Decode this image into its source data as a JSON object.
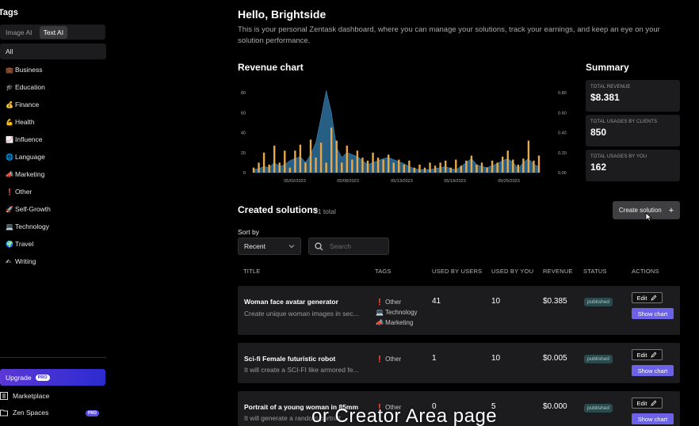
{
  "sidebar": {
    "title": "Tags",
    "toggle": [
      "Image AI",
      "Text AI"
    ],
    "categories": [
      {
        "label": "All",
        "emoji": ""
      },
      {
        "label": "Business",
        "emoji": "💼"
      },
      {
        "label": "Education",
        "emoji": "🎓"
      },
      {
        "label": "Finance",
        "emoji": "💰"
      },
      {
        "label": "Health",
        "emoji": "💪"
      },
      {
        "label": "Influence",
        "emoji": "📈"
      },
      {
        "label": "Language",
        "emoji": "🌐"
      },
      {
        "label": "Marketing",
        "emoji": "📣"
      },
      {
        "label": "Other",
        "emoji": "❗"
      },
      {
        "label": "Self-Growth",
        "emoji": "🚀"
      },
      {
        "label": "Technology",
        "emoji": "💻"
      },
      {
        "label": "Travel",
        "emoji": "🌍"
      },
      {
        "label": "Writing",
        "emoji": "✍"
      }
    ],
    "upgrade_label": "Upgrade",
    "pro": "PRO",
    "marketplace": "Marketplace",
    "zen_spaces": "Zen Spaces"
  },
  "header": {
    "greeting": "Hello, Brightside",
    "intro": "This is your personal Zentask dashboard, where you can manage your solutions, track your earnings, and keep an eye on your solution performance."
  },
  "revenue_title": "Revenue chart",
  "summary": {
    "title": "Summary",
    "cards": [
      {
        "label": "TOTAL REVENUE",
        "value": "$8.381"
      },
      {
        "label": "TOTAL USAGES BY CLIENTS",
        "value": "850"
      },
      {
        "label": "TOTAL USAGES BY YOU",
        "value": "162"
      }
    ]
  },
  "chart_data": {
    "type": "bar",
    "title": "",
    "left_axis_ticks": [
      "80",
      "60",
      "40",
      "20",
      "0"
    ],
    "right_axis_ticks": [
      "0.80",
      "0.60",
      "0.40",
      "0.20",
      "0.00"
    ],
    "x_tick_labels": [
      "05/02/2023",
      "05/08/2023",
      "05/13/2023",
      "05/19/2023",
      "05/25/2023"
    ],
    "ylim": [
      0,
      80
    ],
    "y2lim": [
      0,
      0.8
    ],
    "series": [
      {
        "kind": "area",
        "values": [
          3,
          4,
          6,
          5,
          10,
          6,
          8,
          12,
          14,
          16,
          10,
          18,
          30,
          55,
          82,
          60,
          25,
          15,
          20,
          18,
          16,
          12,
          8,
          10,
          12,
          14,
          15,
          13,
          11,
          9,
          6,
          4,
          3,
          3,
          3,
          4,
          5,
          6,
          4,
          3,
          6,
          10,
          14,
          8,
          6,
          5,
          7,
          9,
          12,
          14,
          10,
          4,
          10,
          14,
          8,
          6
        ]
      },
      {
        "kind": "bar",
        "values": [
          0.05,
          0.1,
          0.2,
          0.08,
          0.27,
          0.1,
          0.22,
          0.05,
          0.22,
          0.28,
          0.1,
          0.33,
          0.15,
          0.3,
          0.1,
          0.45,
          0.32,
          0.1,
          0.27,
          0.13,
          0.22,
          0.15,
          0.12,
          0.2,
          0.15,
          0.13,
          0.18,
          0.1,
          0.13,
          0.08,
          0.12,
          0.05,
          0.08,
          0.05,
          0.1,
          0.07,
          0.1,
          0.12,
          0.05,
          0.13,
          0.07,
          0.12,
          0.17,
          0.08,
          0.1,
          0.05,
          0.12,
          0.1,
          0.16,
          0.22,
          0.13,
          0.08,
          0.14,
          0.32,
          0.12,
          0.17
        ]
      }
    ],
    "colors": {
      "area": "#2d6f9b",
      "bar": "#e8a84a"
    }
  },
  "created": {
    "title": "Created solutions",
    "count": "31 total",
    "create_label": "Create solution",
    "sort_label": "Sort by",
    "sort_value": "Recent",
    "search_placeholder": "Search"
  },
  "table": {
    "headers": [
      "TITLE",
      "TAGS",
      "USED BY USERS",
      "USED BY YOU",
      "REVENUE",
      "STATUS",
      "ACTIONS"
    ],
    "edit_label": "Edit",
    "chart_label": "Show chart",
    "rows": [
      {
        "title": "Woman face avatar generator",
        "desc": "Create unique woman images in sec...",
        "tags": [
          "❗ Other",
          "💻 Technology",
          "📣 Marketing"
        ],
        "users": "41",
        "you": "10",
        "revenue": "$0.385",
        "status": "published"
      },
      {
        "title": "Sci-fi Female futuristic robot",
        "desc": "It will create a SCI-FI like armored fe...",
        "tags": [
          "❗ Other"
        ],
        "users": "1",
        "you": "10",
        "revenue": "$0.005",
        "status": "published"
      },
      {
        "title": "Portrait of a young woman in 85mm",
        "desc": "It will generate a random portrait...",
        "tags": [
          "❗ Other"
        ],
        "users": "0",
        "you": "5",
        "revenue": "$0.000",
        "status": "published"
      }
    ]
  },
  "caption": "or Creator Area page"
}
